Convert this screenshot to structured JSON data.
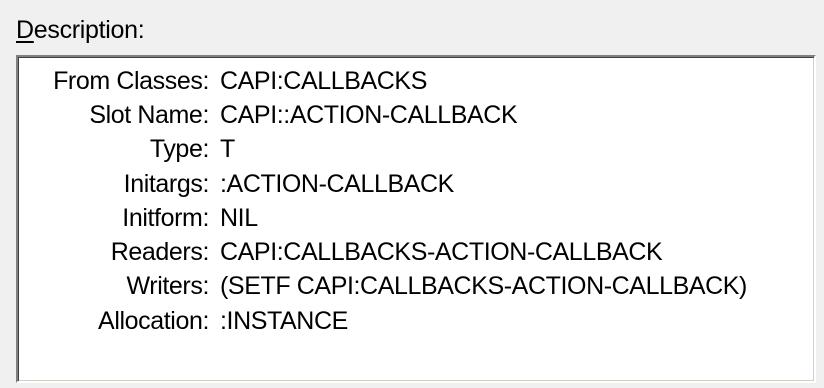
{
  "label": {
    "mnemonic": "D",
    "rest": "escription:"
  },
  "fields": [
    {
      "key": "From Classes:",
      "value": "CAPI:CALLBACKS"
    },
    {
      "key": "Slot Name:",
      "value": "CAPI::ACTION-CALLBACK"
    },
    {
      "key": "Type:",
      "value": "T"
    },
    {
      "key": "Initargs:",
      "value": ":ACTION-CALLBACK"
    },
    {
      "key": "Initform:",
      "value": "NIL"
    },
    {
      "key": "Readers:",
      "value": "CAPI:CALLBACKS-ACTION-CALLBACK"
    },
    {
      "key": "Writers:",
      "value": "(SETF CAPI:CALLBACKS-ACTION-CALLBACK)"
    },
    {
      "key": "Allocation:",
      "value": ":INSTANCE"
    }
  ]
}
